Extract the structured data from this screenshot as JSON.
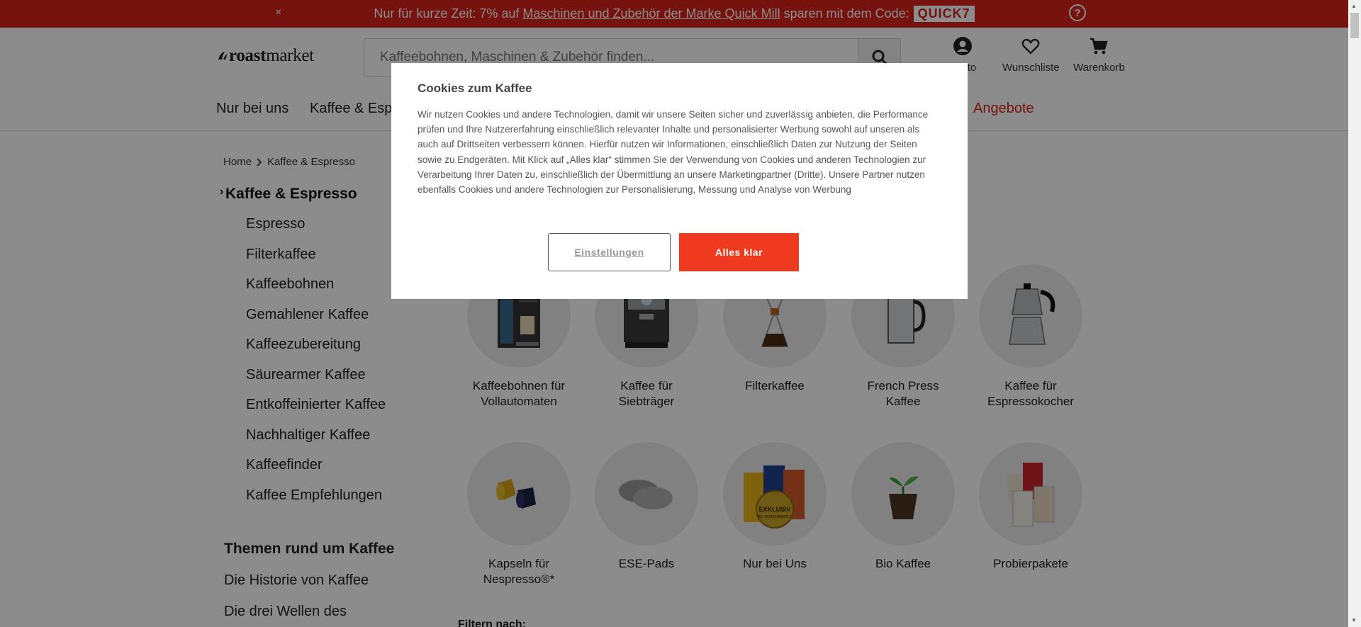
{
  "promo": {
    "text_before": "Nur für kurze Zeit: 7% auf",
    "link": "Maschinen und Zubehör der Marke Quick Mill",
    "text_after": "sparen mit dem Code:",
    "code": "QUICK7",
    "close": "×",
    "help": "?"
  },
  "header": {
    "logo_bold": "roast",
    "logo_rest": "market",
    "search_placeholder": "Kaffeebohnen, Maschinen & Zubehör finden...",
    "account": "Konto",
    "wishlist": "Wunschliste",
    "cart": "Warenkorb"
  },
  "nav": {
    "items": [
      "Nur bei uns",
      "Kaffee & Espresso",
      "Angebote"
    ]
  },
  "breadcrumb": {
    "home": "Home",
    "current": "Kaffee & Espresso"
  },
  "sidebar": {
    "title": "Kaffee & Espresso",
    "items": [
      "Espresso",
      "Filterkaffee",
      "Kaffeebohnen",
      "Gemahlener Kaffee",
      "Kaffeezubereitung",
      "Säurearmer Kaffee",
      "Entkoffeinierter Kaffee",
      "Nachhaltiger Kaffee",
      "Kaffeefinder",
      "Kaffee Empfehlungen"
    ],
    "section_title": "Themen rund um Kaffee",
    "topics": [
      "Die Historie von Kaffee",
      "Die drei Wellen des"
    ]
  },
  "categories": [
    {
      "line1": "Kaffeebohnen für",
      "line2": "Vollautomaten"
    },
    {
      "line1": "Kaffee für",
      "line2": "Siebträger"
    },
    {
      "line1": "Filterkaffee",
      "line2": ""
    },
    {
      "line1": "French Press",
      "line2": "Kaffee"
    },
    {
      "line1": "Kaffee für",
      "line2": "Espressokocher"
    },
    {
      "line1": "Kapseln für",
      "line2": "Nespresso®*"
    },
    {
      "line1": "ESE-Pads",
      "line2": ""
    },
    {
      "line1": "Nur bei Uns",
      "line2": ""
    },
    {
      "line1": "Bio Kaffee",
      "line2": ""
    },
    {
      "line1": "Probierpakete",
      "line2": ""
    }
  ],
  "badge": {
    "line1": "EXKLUSIV",
    "line2": "BEI ROASTMARKET"
  },
  "filter_label": "Filtern nach:",
  "cookie": {
    "title": "Cookies zum Kaffee",
    "body": "Wir nutzen Cookies und andere Technologien, damit wir unsere Seiten sicher und zuverlässig anbieten, die Performance prüfen und Ihre Nutzererfahrung einschließlich relevanter Inhalte und personalisierter Werbung sowohl auf unseren als auch auf Drittseiten verbessern können. Hierfür nutzen wir Informationen, einschließlich Daten zur Nutzung der Seiten sowie zu Endgeräten. Mit Klick auf „Alles klar“ stimmen Sie der Verwendung von Cookies und anderen Technologien zur Verarbeitung Ihrer Daten zu, einschließlich der Übermittlung an unsere Marketingpartner (Dritte). Unsere Partner nutzen ebenfalls Cookies und andere Technologien zur Personalisierung, Messung und Analyse von Werbung",
    "settings_label": "Einstellungen",
    "accept_label": "Alles klar"
  },
  "colors": {
    "brand_red": "#d8231a",
    "accept_button": "#f03a1f"
  }
}
